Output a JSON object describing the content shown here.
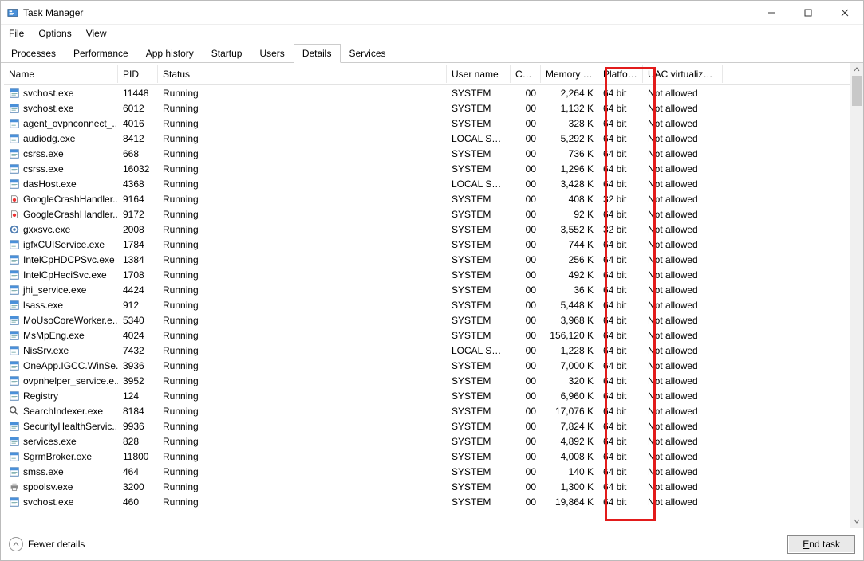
{
  "window": {
    "title": "Task Manager"
  },
  "menu": {
    "file": "File",
    "options": "Options",
    "view": "View"
  },
  "tabs": {
    "processes": "Processes",
    "performance": "Performance",
    "apphistory": "App history",
    "startup": "Startup",
    "users": "Users",
    "details": "Details",
    "services": "Services",
    "active": "details"
  },
  "columns": {
    "name": "Name",
    "pid": "PID",
    "status": "Status",
    "user": "User name",
    "cpu": "CPU",
    "mem": "Memory (a...",
    "platform": "Platform",
    "uac": "UAC virtualizat..."
  },
  "footer": {
    "fewer": "Fewer details",
    "end": "End task"
  },
  "rows": [
    {
      "icon": "exe",
      "name": "svchost.exe",
      "pid": "11448",
      "status": "Running",
      "user": "SYSTEM",
      "cpu": "00",
      "mem": "2,264 K",
      "plat": "64 bit",
      "uac": "Not allowed"
    },
    {
      "icon": "exe",
      "name": "svchost.exe",
      "pid": "6012",
      "status": "Running",
      "user": "SYSTEM",
      "cpu": "00",
      "mem": "1,132 K",
      "plat": "64 bit",
      "uac": "Not allowed"
    },
    {
      "icon": "exe",
      "name": "agent_ovpnconnect_...",
      "pid": "4016",
      "status": "Running",
      "user": "SYSTEM",
      "cpu": "00",
      "mem": "328 K",
      "plat": "64 bit",
      "uac": "Not allowed"
    },
    {
      "icon": "exe",
      "name": "audiodg.exe",
      "pid": "8412",
      "status": "Running",
      "user": "LOCAL SE...",
      "cpu": "00",
      "mem": "5,292 K",
      "plat": "64 bit",
      "uac": "Not allowed"
    },
    {
      "icon": "exe",
      "name": "csrss.exe",
      "pid": "668",
      "status": "Running",
      "user": "SYSTEM",
      "cpu": "00",
      "mem": "736 K",
      "plat": "64 bit",
      "uac": "Not allowed"
    },
    {
      "icon": "exe",
      "name": "csrss.exe",
      "pid": "16032",
      "status": "Running",
      "user": "SYSTEM",
      "cpu": "00",
      "mem": "1,296 K",
      "plat": "64 bit",
      "uac": "Not allowed"
    },
    {
      "icon": "exe",
      "name": "dasHost.exe",
      "pid": "4368",
      "status": "Running",
      "user": "LOCAL SE...",
      "cpu": "00",
      "mem": "3,428 K",
      "plat": "64 bit",
      "uac": "Not allowed"
    },
    {
      "icon": "gcrash",
      "name": "GoogleCrashHandler...",
      "pid": "9164",
      "status": "Running",
      "user": "SYSTEM",
      "cpu": "00",
      "mem": "408 K",
      "plat": "32 bit",
      "uac": "Not allowed"
    },
    {
      "icon": "gcrash",
      "name": "GoogleCrashHandler...",
      "pid": "9172",
      "status": "Running",
      "user": "SYSTEM",
      "cpu": "00",
      "mem": "92 K",
      "plat": "64 bit",
      "uac": "Not allowed"
    },
    {
      "icon": "gear",
      "name": "gxxsvc.exe",
      "pid": "2008",
      "status": "Running",
      "user": "SYSTEM",
      "cpu": "00",
      "mem": "3,552 K",
      "plat": "32 bit",
      "uac": "Not allowed"
    },
    {
      "icon": "exe",
      "name": "igfxCUIService.exe",
      "pid": "1784",
      "status": "Running",
      "user": "SYSTEM",
      "cpu": "00",
      "mem": "744 K",
      "plat": "64 bit",
      "uac": "Not allowed"
    },
    {
      "icon": "exe",
      "name": "IntelCpHDCPSvc.exe",
      "pid": "1384",
      "status": "Running",
      "user": "SYSTEM",
      "cpu": "00",
      "mem": "256 K",
      "plat": "64 bit",
      "uac": "Not allowed"
    },
    {
      "icon": "exe",
      "name": "IntelCpHeciSvc.exe",
      "pid": "1708",
      "status": "Running",
      "user": "SYSTEM",
      "cpu": "00",
      "mem": "492 K",
      "plat": "64 bit",
      "uac": "Not allowed"
    },
    {
      "icon": "exe",
      "name": "jhi_service.exe",
      "pid": "4424",
      "status": "Running",
      "user": "SYSTEM",
      "cpu": "00",
      "mem": "36 K",
      "plat": "64 bit",
      "uac": "Not allowed"
    },
    {
      "icon": "exe",
      "name": "lsass.exe",
      "pid": "912",
      "status": "Running",
      "user": "SYSTEM",
      "cpu": "00",
      "mem": "5,448 K",
      "plat": "64 bit",
      "uac": "Not allowed"
    },
    {
      "icon": "exe",
      "name": "MoUsoCoreWorker.e...",
      "pid": "5340",
      "status": "Running",
      "user": "SYSTEM",
      "cpu": "00",
      "mem": "3,968 K",
      "plat": "64 bit",
      "uac": "Not allowed"
    },
    {
      "icon": "exe",
      "name": "MsMpEng.exe",
      "pid": "4024",
      "status": "Running",
      "user": "SYSTEM",
      "cpu": "00",
      "mem": "156,120 K",
      "plat": "64 bit",
      "uac": "Not allowed"
    },
    {
      "icon": "exe",
      "name": "NisSrv.exe",
      "pid": "7432",
      "status": "Running",
      "user": "LOCAL SE...",
      "cpu": "00",
      "mem": "1,228 K",
      "plat": "64 bit",
      "uac": "Not allowed"
    },
    {
      "icon": "exe",
      "name": "OneApp.IGCC.WinSe...",
      "pid": "3936",
      "status": "Running",
      "user": "SYSTEM",
      "cpu": "00",
      "mem": "7,000 K",
      "plat": "64 bit",
      "uac": "Not allowed"
    },
    {
      "icon": "exe",
      "name": "ovpnhelper_service.e...",
      "pid": "3952",
      "status": "Running",
      "user": "SYSTEM",
      "cpu": "00",
      "mem": "320 K",
      "plat": "64 bit",
      "uac": "Not allowed"
    },
    {
      "icon": "exe",
      "name": "Registry",
      "pid": "124",
      "status": "Running",
      "user": "SYSTEM",
      "cpu": "00",
      "mem": "6,960 K",
      "plat": "64 bit",
      "uac": "Not allowed"
    },
    {
      "icon": "search",
      "name": "SearchIndexer.exe",
      "pid": "8184",
      "status": "Running",
      "user": "SYSTEM",
      "cpu": "00",
      "mem": "17,076 K",
      "plat": "64 bit",
      "uac": "Not allowed"
    },
    {
      "icon": "exe",
      "name": "SecurityHealthServic...",
      "pid": "9936",
      "status": "Running",
      "user": "SYSTEM",
      "cpu": "00",
      "mem": "7,824 K",
      "plat": "64 bit",
      "uac": "Not allowed"
    },
    {
      "icon": "exe",
      "name": "services.exe",
      "pid": "828",
      "status": "Running",
      "user": "SYSTEM",
      "cpu": "00",
      "mem": "4,892 K",
      "plat": "64 bit",
      "uac": "Not allowed"
    },
    {
      "icon": "exe",
      "name": "SgrmBroker.exe",
      "pid": "11800",
      "status": "Running",
      "user": "SYSTEM",
      "cpu": "00",
      "mem": "4,008 K",
      "plat": "64 bit",
      "uac": "Not allowed"
    },
    {
      "icon": "exe",
      "name": "smss.exe",
      "pid": "464",
      "status": "Running",
      "user": "SYSTEM",
      "cpu": "00",
      "mem": "140 K",
      "plat": "64 bit",
      "uac": "Not allowed"
    },
    {
      "icon": "printer",
      "name": "spoolsv.exe",
      "pid": "3200",
      "status": "Running",
      "user": "SYSTEM",
      "cpu": "00",
      "mem": "1,300 K",
      "plat": "64 bit",
      "uac": "Not allowed"
    },
    {
      "icon": "exe",
      "name": "svchost.exe",
      "pid": "460",
      "status": "Running",
      "user": "SYSTEM",
      "cpu": "00",
      "mem": "19,864 K",
      "plat": "64 bit",
      "uac": "Not allowed"
    }
  ]
}
